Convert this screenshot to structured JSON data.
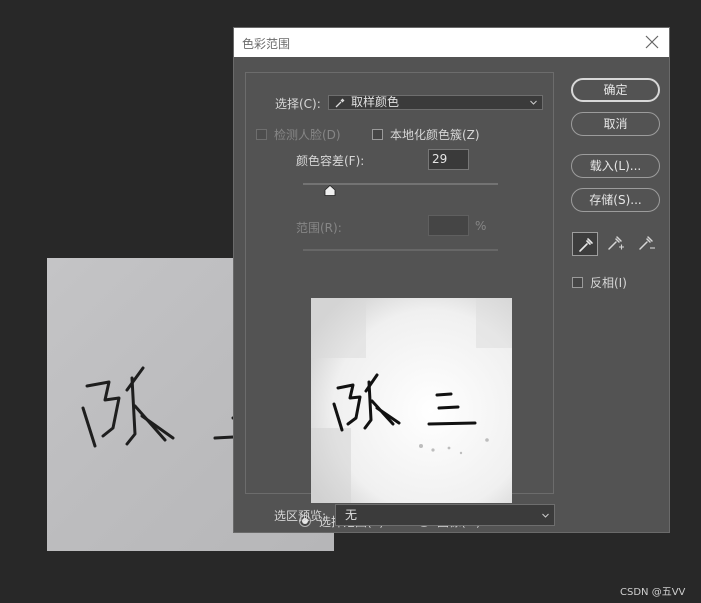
{
  "dialog": {
    "title": "色彩范围",
    "select_label": "选择(C):",
    "select_value": "取样颜色",
    "detect_faces_label": "检测人脸(D)",
    "localized_label": "本地化颜色簇(Z)",
    "fuzziness_label": "颜色容差(F):",
    "fuzziness_value": "29",
    "fuzziness_level_percent": 14,
    "range_label": "范围(R):",
    "range_value": "",
    "range_unit": "%",
    "preview_mode": {
      "selection_label": "选择范围(E)",
      "image_label": "图像(M)",
      "selected": "selection"
    },
    "selection_preview_label": "选区预览:",
    "selection_preview_value": "无",
    "buttons": {
      "ok": "确定",
      "cancel": "取消",
      "load": "载入(L)...",
      "save": "存储(S)..."
    },
    "invert_label": "反相(I)"
  },
  "preview_text": "张 三",
  "watermark": "CSDN @五VV",
  "colors": {
    "dialog_bg": "#535353",
    "app_bg": "#282828",
    "title_bg": "#ffffff"
  }
}
